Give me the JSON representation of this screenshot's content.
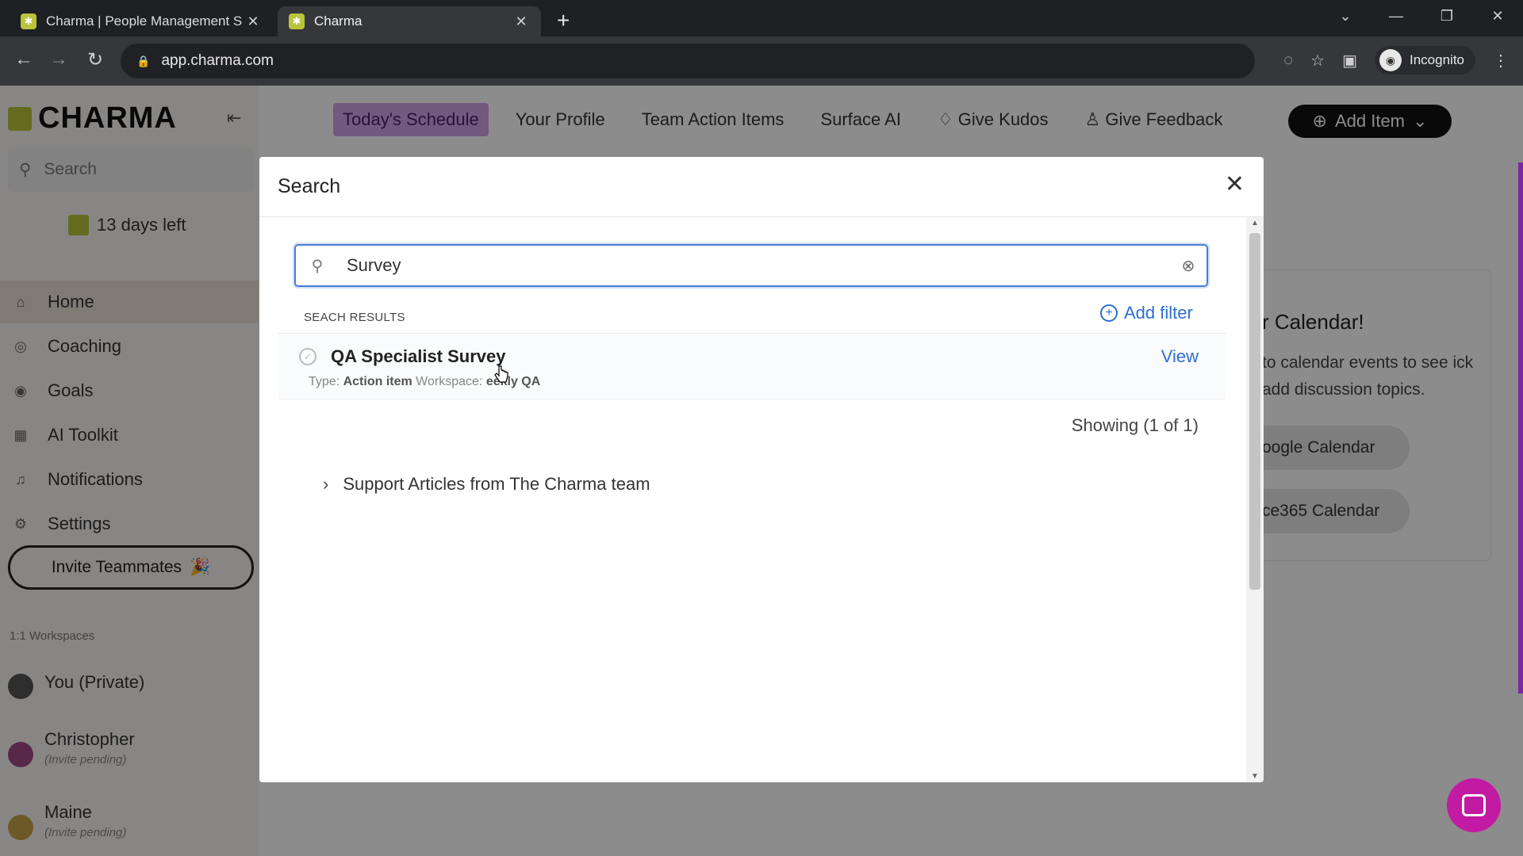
{
  "browser": {
    "tabs": [
      {
        "label": "Charma | People Management S",
        "active": false
      },
      {
        "label": "Charma",
        "active": true
      }
    ],
    "url": "app.charma.com",
    "profile_label": "Incognito"
  },
  "sidebar": {
    "logo": "CHARMA",
    "search_placeholder": "Search",
    "trial": "13 days left",
    "nav": [
      {
        "label": "Home",
        "icon": "home-icon"
      },
      {
        "label": "Coaching",
        "icon": "coaching-icon"
      },
      {
        "label": "Goals",
        "icon": "goals-icon"
      },
      {
        "label": "AI Toolkit",
        "icon": "robot-icon"
      },
      {
        "label": "Notifications",
        "icon": "bell-icon"
      },
      {
        "label": "Settings",
        "icon": "gear-icon"
      }
    ],
    "invite_label": "Invite Teammates",
    "workspaces_title": "1:1 Workspaces",
    "workspaces": [
      {
        "name": "You (Private)",
        "sub": ""
      },
      {
        "name": "Christopher",
        "sub": "(Invite pending)"
      },
      {
        "name": "Maine",
        "sub": "(Invite pending)"
      }
    ]
  },
  "topnav": {
    "items": [
      "Today's Schedule",
      "Your Profile",
      "Team Action Items",
      "Surface AI",
      "Give Kudos",
      "Give Feedback"
    ],
    "add_item": "Add Item"
  },
  "calendar_card": {
    "title_visible": "r Calendar!",
    "body_visible": "to calendar events to see ick add discussion topics.",
    "btn1": "oogle Calendar",
    "btn2": "ce365 Calendar"
  },
  "modal": {
    "title": "Search",
    "search_value": "Survey",
    "results_label": "SEACH RESULTS",
    "add_filter": "Add filter",
    "result": {
      "title": "QA Specialist Survey",
      "type_label": "Type:",
      "type_value": "Action item",
      "workspace_label": "Workspace:",
      "workspace_value": "eekly QA",
      "view_label": "View"
    },
    "showing": "Showing (1 of 1)",
    "support_label": "Support Articles from The Charma team"
  },
  "colors": {
    "accent_blue": "#2d6fd0",
    "brand_green": "#b7c43a",
    "active_tab_purple": "#cfa3e6",
    "chat_magenta": "#c21aa3"
  }
}
